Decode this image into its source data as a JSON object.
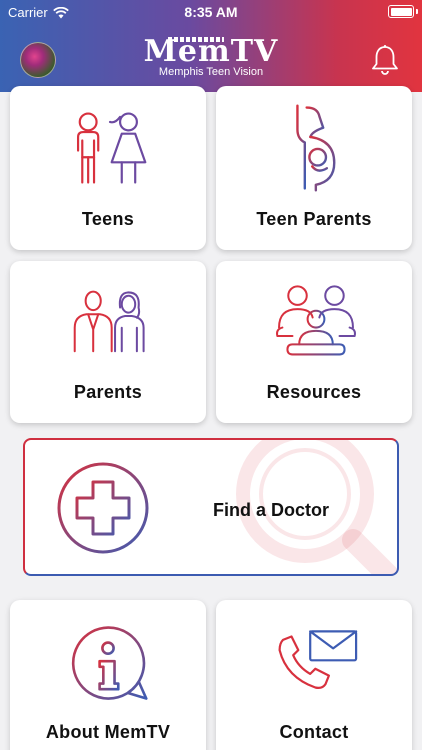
{
  "status_bar": {
    "carrier": "Carrier",
    "time": "8:35 AM"
  },
  "header": {
    "logo_title": "MemTV",
    "logo_subtitle": "Memphis Teen Vision",
    "avatar_icon": "profile-photo",
    "bell_icon": "bell-icon"
  },
  "cards": [
    {
      "label": "Teens",
      "icon": "teens-icon"
    },
    {
      "label": "Teen Parents",
      "icon": "pregnant-woman-icon"
    },
    {
      "label": "Parents",
      "icon": "parents-icon"
    },
    {
      "label": "Resources",
      "icon": "family-icon"
    },
    {
      "label": "Find a Doctor",
      "icon": "medical-cross-icon"
    },
    {
      "label": "About MemTV",
      "icon": "info-bubble-icon"
    },
    {
      "label": "Contact",
      "icon": "phone-mail-icon"
    }
  ],
  "colors": {
    "red": "#d8313e",
    "blue": "#3d5cb3",
    "gradient_start": "#3a63b3",
    "gradient_end": "#e1343f"
  }
}
